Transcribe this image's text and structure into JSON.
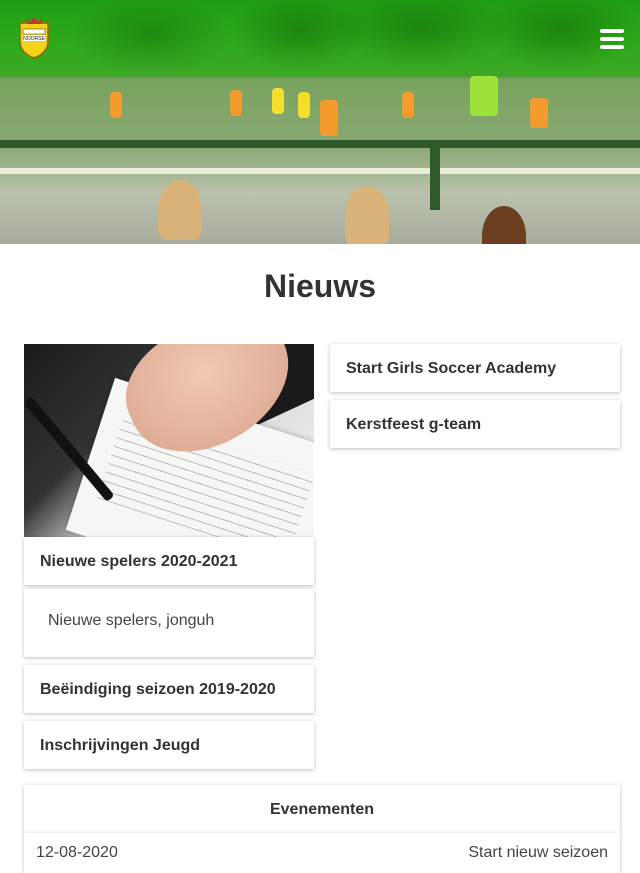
{
  "header": {
    "logo_text": "NOORSE",
    "menu_icon": "hamburger-menu-icon"
  },
  "page": {
    "title": "Nieuws"
  },
  "news": {
    "left": [
      {
        "title": "Nieuwe spelers 2020-2021",
        "excerpt": "Nieuwe spelers, jonguh",
        "image": "contract-signing-photo"
      },
      {
        "title": "Beëindiging seizoen 2019-2020"
      },
      {
        "title": "Inschrijvingen Jeugd"
      }
    ],
    "right": [
      {
        "title": "Start Girls Soccer Academy"
      },
      {
        "title": "Kerstfeest g-team"
      }
    ]
  },
  "events": {
    "header": "Evenementen",
    "items": [
      {
        "date": "12-08-2020",
        "name": "Start nieuw seizoen"
      }
    ]
  },
  "colors": {
    "brand_green": "#2faa1c",
    "text": "#333333"
  }
}
